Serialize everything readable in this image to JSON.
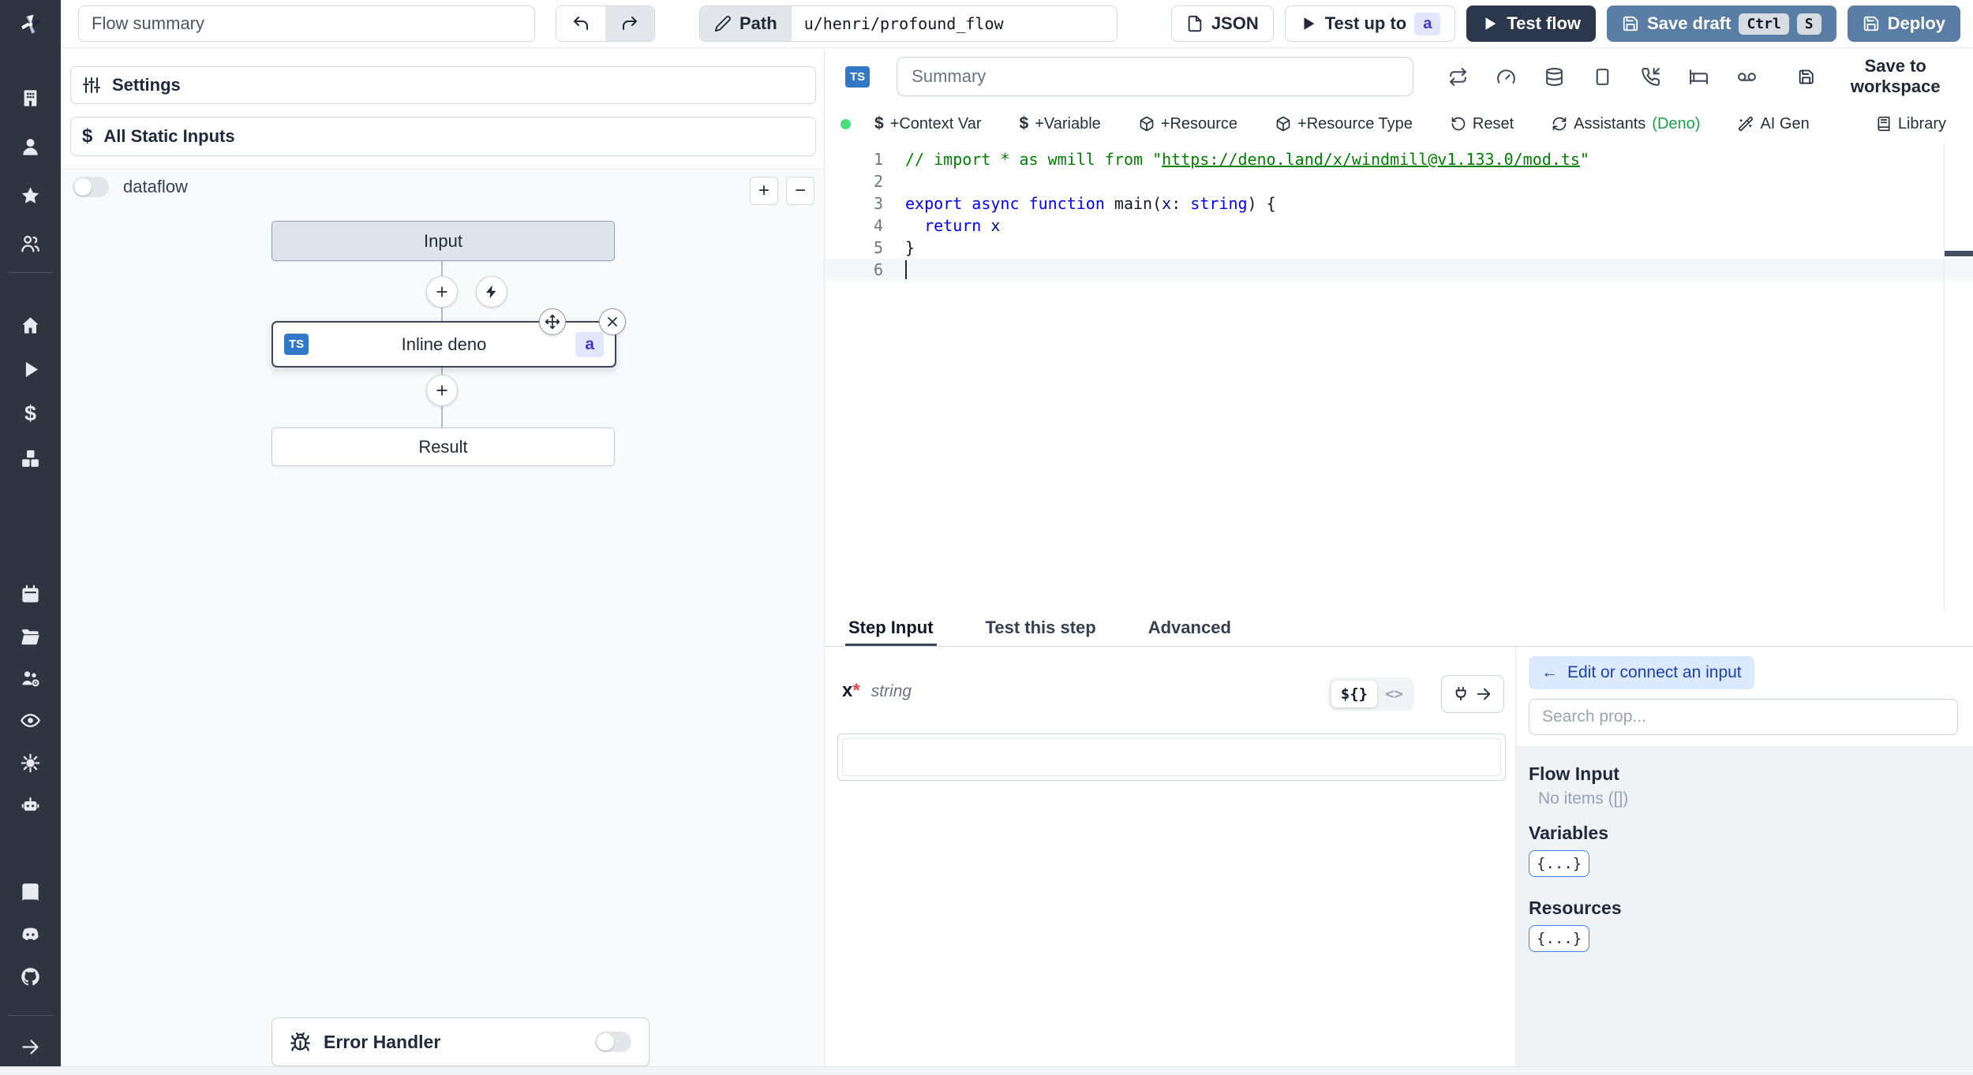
{
  "topbar": {
    "flow_summary_placeholder": "Flow summary",
    "path_label": "Path",
    "path_value": "u/henri/profound_flow",
    "json_button": "JSON",
    "test_up_to_label": "Test up to",
    "test_up_to_badge": "a",
    "test_flow_label": "Test flow",
    "save_draft_label": "Save draft",
    "kbd_ctrl": "Ctrl",
    "kbd_s": "S",
    "deploy_label": "Deploy"
  },
  "sidebar": {
    "icons": [
      "windmill-logo",
      "building",
      "user",
      "star",
      "users",
      "home",
      "play",
      "dollar",
      "boxes",
      "calendar",
      "folder-open",
      "users-cog",
      "eye",
      "gear",
      "bot",
      "book",
      "discord",
      "github",
      "arrow-right"
    ]
  },
  "flow_panel": {
    "settings_label": "Settings",
    "all_static_inputs_label": "All Static Inputs",
    "dataflow_label": "dataflow",
    "zoom_in_label": "+",
    "zoom_out_label": "−",
    "graph": {
      "input_node": "Input",
      "step_node": "Inline deno",
      "step_lang_badge": "TS",
      "step_id_badge": "a",
      "result_node": "Result"
    },
    "error_handler_label": "Error Handler"
  },
  "editor": {
    "lang_badge": "TS",
    "summary_placeholder": "Summary",
    "save_to_workspace_label": "Save to workspace",
    "toolbar": {
      "context_var": "+Context Var",
      "variable": "+Variable",
      "resource": "+Resource",
      "resource_type": "+Resource Type",
      "reset": "Reset",
      "assistants": "Assistants",
      "assistants_lang": "(Deno)",
      "ai_gen": "AI Gen",
      "library": "Library"
    },
    "code": {
      "lines": [
        {
          "num": "1",
          "segs": [
            {
              "c": "comment",
              "t": "// import * as wmill from \""
            },
            {
              "c": "comment-link",
              "t": "https://deno.land/x/windmill@v1.133.0/mod.ts"
            },
            {
              "c": "comment",
              "t": "\""
            }
          ]
        },
        {
          "num": "2",
          "segs": []
        },
        {
          "num": "3",
          "segs": [
            {
              "c": "kw",
              "t": "export"
            },
            {
              "c": "pl",
              "t": " "
            },
            {
              "c": "kw",
              "t": "async"
            },
            {
              "c": "pl",
              "t": " "
            },
            {
              "c": "kw",
              "t": "function"
            },
            {
              "c": "pl",
              "t": " main("
            },
            {
              "c": "var",
              "t": "x"
            },
            {
              "c": "pl",
              "t": ": "
            },
            {
              "c": "kw",
              "t": "string"
            },
            {
              "c": "pl",
              "t": ") {"
            }
          ]
        },
        {
          "num": "4",
          "segs": [
            {
              "c": "pl",
              "t": "  "
            },
            {
              "c": "kw",
              "t": "return"
            },
            {
              "c": "var",
              "t": " x"
            }
          ]
        },
        {
          "num": "5",
          "segs": [
            {
              "c": "pl",
              "t": "}"
            }
          ]
        },
        {
          "num": "6",
          "segs": [],
          "cursor": true,
          "active": true
        }
      ]
    }
  },
  "step_panel": {
    "tabs": [
      {
        "label": "Step Input",
        "active": true
      },
      {
        "label": "Test this step",
        "active": false
      },
      {
        "label": "Advanced",
        "active": false
      }
    ],
    "field": {
      "name": "x",
      "required_marker": "*",
      "type": "string"
    },
    "mode_toggle": {
      "template": "${}",
      "code": "<>"
    }
  },
  "connect_panel": {
    "edit_button_label": "Edit or connect an input",
    "search_placeholder": "Search prop...",
    "flow_input_title": "Flow Input",
    "flow_input_empty": "No items ([])",
    "variables_title": "Variables",
    "variables_badge": "{...}",
    "resources_title": "Resources",
    "resources_badge": "{...}"
  },
  "colors": {
    "sidebar_bg": "#2e3440",
    "dark_button": "#2b374c",
    "steel_button": "#5a7da6",
    "ts_badge_bg": "#3178c6",
    "id_badge_bg": "#e0e7ff",
    "id_badge_text": "#4338ca",
    "status_green_dot": "#4ade80",
    "deno_green": "#16a34a",
    "code_comment_green": "#008000",
    "code_keyword_blue": "#0000ff",
    "edit_button_bg": "#dbeafe",
    "edit_button_text": "#1e40af"
  }
}
